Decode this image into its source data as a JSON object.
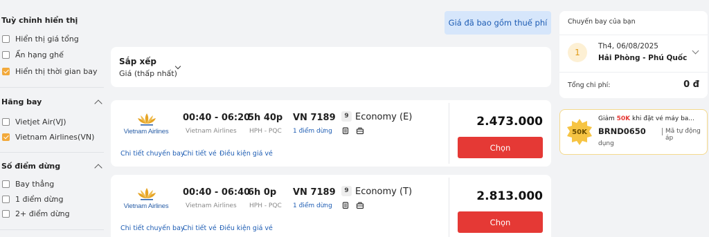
{
  "filters": {
    "display": {
      "title": "Tuỳ chỉnh hiển thị",
      "options": [
        {
          "label": "Hiển thị giá tổng",
          "checked": false
        },
        {
          "label": "Ẩn hạng ghế",
          "checked": false
        },
        {
          "label": "Hiển thị thời gian bay",
          "checked": true
        }
      ]
    },
    "airlines": {
      "title": "Hãng bay",
      "options": [
        {
          "label": "Vietjet Air(VJ)",
          "checked": false
        },
        {
          "label": "Vietnam Airlines(VN)",
          "checked": true
        }
      ]
    },
    "stops": {
      "title": "Số điểm dừng",
      "options": [
        {
          "label": "Bay thẳng",
          "checked": false
        },
        {
          "label": "1 điểm dừng",
          "checked": false
        },
        {
          "label": "2+ điểm dừng",
          "checked": false
        }
      ]
    }
  },
  "tax_note": "Giá đã bao gồm thuế phí",
  "sort": {
    "title": "Sắp xếp",
    "value": "Giá (thấp nhất)"
  },
  "flights": [
    {
      "airline_logo_text": "Vietnam Airlines",
      "time": "00:40 - 06:20",
      "airline": "Vietnam Airlines",
      "duration": "5h 40p",
      "route": "HPH - PQC",
      "flight_no": "VN 7189",
      "stops": "1 điểm dừng",
      "seats": "9",
      "cabin": "Economy (E)",
      "price": "2.473.000",
      "select_label": "Chọn",
      "links": [
        "Chi tiết chuyến bay",
        "Chi tiết vé",
        "Điều kiện giá vé"
      ]
    },
    {
      "airline_logo_text": "Vietnam Airlines",
      "time": "00:40 - 06:40",
      "airline": "Vietnam Airlines",
      "duration": "6h 0p",
      "route": "HPH - PQC",
      "flight_no": "VN 7189",
      "stops": "1 điểm dừng",
      "seats": "9",
      "cabin": "Economy (T)",
      "price": "2.813.000",
      "select_label": "Chọn",
      "links": [
        "Chi tiết chuyến bay",
        "Chi tiết vé",
        "Điều kiện giá vé"
      ]
    }
  ],
  "summary": {
    "heading": "Chuyến bay của bạn",
    "leg_number": "1",
    "date": "Th4, 06/08/2025",
    "route": "Hải Phòng - Phú Quốc",
    "total_label": "Tổng chi phí:",
    "total_value": "0 đ"
  },
  "promo": {
    "badge": "50K",
    "line_prefix": "Giảm ",
    "line_amount": "50K",
    "line_suffix": " khi đặt vé máy ba...",
    "code": "BRND0650",
    "auto_text_1": "Mã tự động áp",
    "auto_text_2": "dụng"
  },
  "colors": {
    "accent": "#f2a93b",
    "select_button": "#e53935",
    "link_blue": "#1d5cb3",
    "tax_note_bg": "#d6e6fb"
  }
}
